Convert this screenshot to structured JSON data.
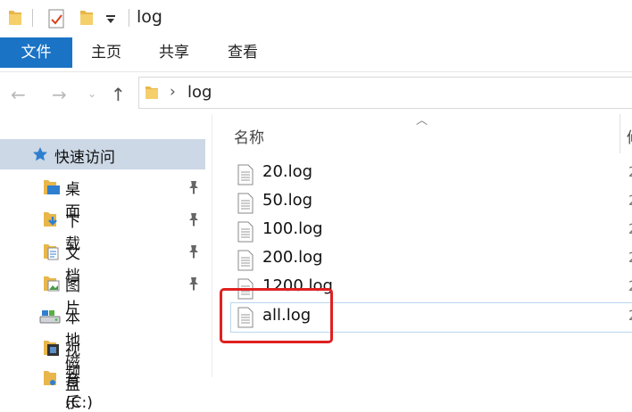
{
  "window": {
    "title": "log"
  },
  "ribbon": {
    "tabs": [
      "文件",
      "主页",
      "共享",
      "查看"
    ]
  },
  "address": {
    "path": "log",
    "separator": "›"
  },
  "nav": {
    "quick_access_label": "快速访问",
    "items": [
      {
        "label": "桌面",
        "icon": "desktop-icon",
        "pinned": true
      },
      {
        "label": "下载",
        "icon": "download-icon",
        "pinned": true
      },
      {
        "label": "文档",
        "icon": "document-icon",
        "pinned": true
      },
      {
        "label": "图片",
        "icon": "picture-icon",
        "pinned": true
      },
      {
        "label": "本地磁盘 (C:)",
        "icon": "drive-icon",
        "pinned": false
      },
      {
        "label": "视频",
        "icon": "video-icon",
        "pinned": false
      },
      {
        "label": "音乐",
        "icon": "music-icon",
        "pinned": false
      }
    ]
  },
  "list": {
    "column_name": "名称",
    "files": [
      {
        "name": "20.log",
        "date": "2"
      },
      {
        "name": "50.log",
        "date": "2"
      },
      {
        "name": "100.log",
        "date": "2"
      },
      {
        "name": "200.log",
        "date": "2"
      },
      {
        "name": "1200.log",
        "date": "2"
      },
      {
        "name": "all.log",
        "date": "2"
      }
    ]
  },
  "colors": {
    "file_tab": "#1a73c5",
    "selection": "#ccd8e6",
    "highlight": "#e02020",
    "folder": "#e8b64a"
  }
}
